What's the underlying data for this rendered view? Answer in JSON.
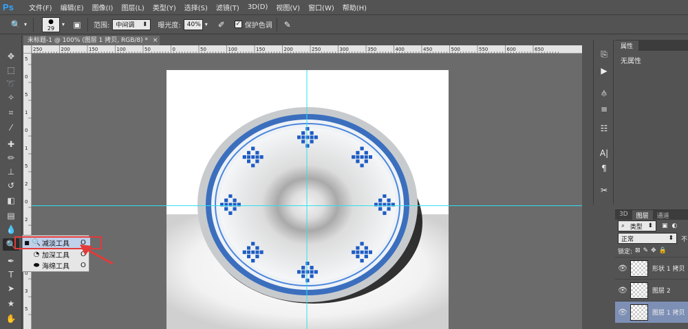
{
  "app": {
    "logo": "Ps"
  },
  "menu": [
    "文件(F)",
    "编辑(E)",
    "图像(I)",
    "图层(L)",
    "类型(Y)",
    "选择(S)",
    "滤镜(T)",
    "3D(D)",
    "视图(V)",
    "窗口(W)",
    "帮助(H)"
  ],
  "options": {
    "brush_size": "29",
    "range_label": "范围:",
    "range_value": "中间调",
    "exposure_label": "曝光度:",
    "exposure_value": "40%",
    "protect_label": "保护色调"
  },
  "document": {
    "tab_title": "未标题-1 @ 100% (图层 1 拷贝, RGB/8) *",
    "close": "×"
  },
  "ruler_h_labels": [
    "250",
    "200",
    "150",
    "100",
    "50",
    "0",
    "50",
    "100",
    "150",
    "200",
    "250",
    "300",
    "350",
    "400",
    "450",
    "500",
    "550",
    "600",
    "650"
  ],
  "ruler_v_labels": [
    "5",
    "0",
    "5",
    "1",
    "0",
    "1",
    "5",
    "2",
    "0",
    "2",
    "5",
    "3",
    "0",
    "3",
    "5"
  ],
  "flyout": [
    {
      "label": "减淡工具",
      "key": "O",
      "icon": "dodge-icon",
      "active": true
    },
    {
      "label": "加深工具",
      "key": "O",
      "icon": "burn-icon",
      "active": false
    },
    {
      "label": "海绵工具",
      "key": "O",
      "icon": "sponge-icon",
      "active": false
    }
  ],
  "properties": {
    "tab": "属性",
    "body": "无属性"
  },
  "layers": {
    "tabs": [
      "3D",
      "图层",
      "通道"
    ],
    "filter": "类型",
    "blend": "正常",
    "opacity_short": "不",
    "lock_label": "锁定:",
    "items": [
      {
        "name": "形状 1 拷贝",
        "selected": false
      },
      {
        "name": "图层 2",
        "selected": false
      },
      {
        "name": "图层 1 拷贝",
        "selected": true
      }
    ]
  },
  "colors": {
    "accent_blue": "#3b6fbe",
    "guide": "#2ee0ef",
    "highlight_red": "#e33a3a"
  }
}
